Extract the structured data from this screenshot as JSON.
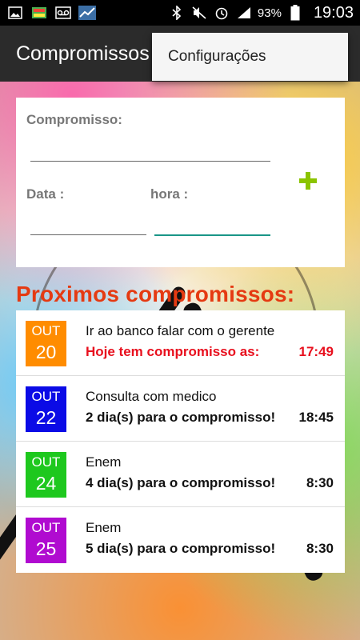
{
  "status_bar": {
    "battery": "93%",
    "time": "19:03"
  },
  "app": {
    "title": "Compromissos"
  },
  "menu": {
    "items": [
      "Configurações"
    ]
  },
  "form": {
    "compromisso_label": "Compromisso:",
    "compromisso_value": "",
    "data_label": "Data :",
    "data_value": "",
    "hora_label": "hora :",
    "hora_value": ""
  },
  "list_title": "Proximos compromissos:",
  "appointments": [
    {
      "month": "OUT",
      "day": "20",
      "title": "Ir ao banco falar com o gerente",
      "status": "Hoje tem compromisso as:",
      "time": "17:49",
      "color": "#ff8c00",
      "today": true
    },
    {
      "month": "OUT",
      "day": "22",
      "title": "Consulta com medico",
      "status": "2 dia(s) para o compromisso!",
      "time": "18:45",
      "color": "#0b0be6",
      "today": false
    },
    {
      "month": "OUT",
      "day": "24",
      "title": "Enem",
      "status": "4 dia(s) para o compromisso!",
      "time": "8:30",
      "color": "#1ec81e",
      "today": false
    },
    {
      "month": "OUT",
      "day": "25",
      "title": "Enem",
      "status": "5 dia(s) para o compromisso!",
      "time": "8:30",
      "color": "#b00bd0",
      "today": false
    }
  ],
  "colors": {
    "accent_add": "#8bc400",
    "section_title": "#e53a12",
    "focus_underline": "#1a9688"
  }
}
